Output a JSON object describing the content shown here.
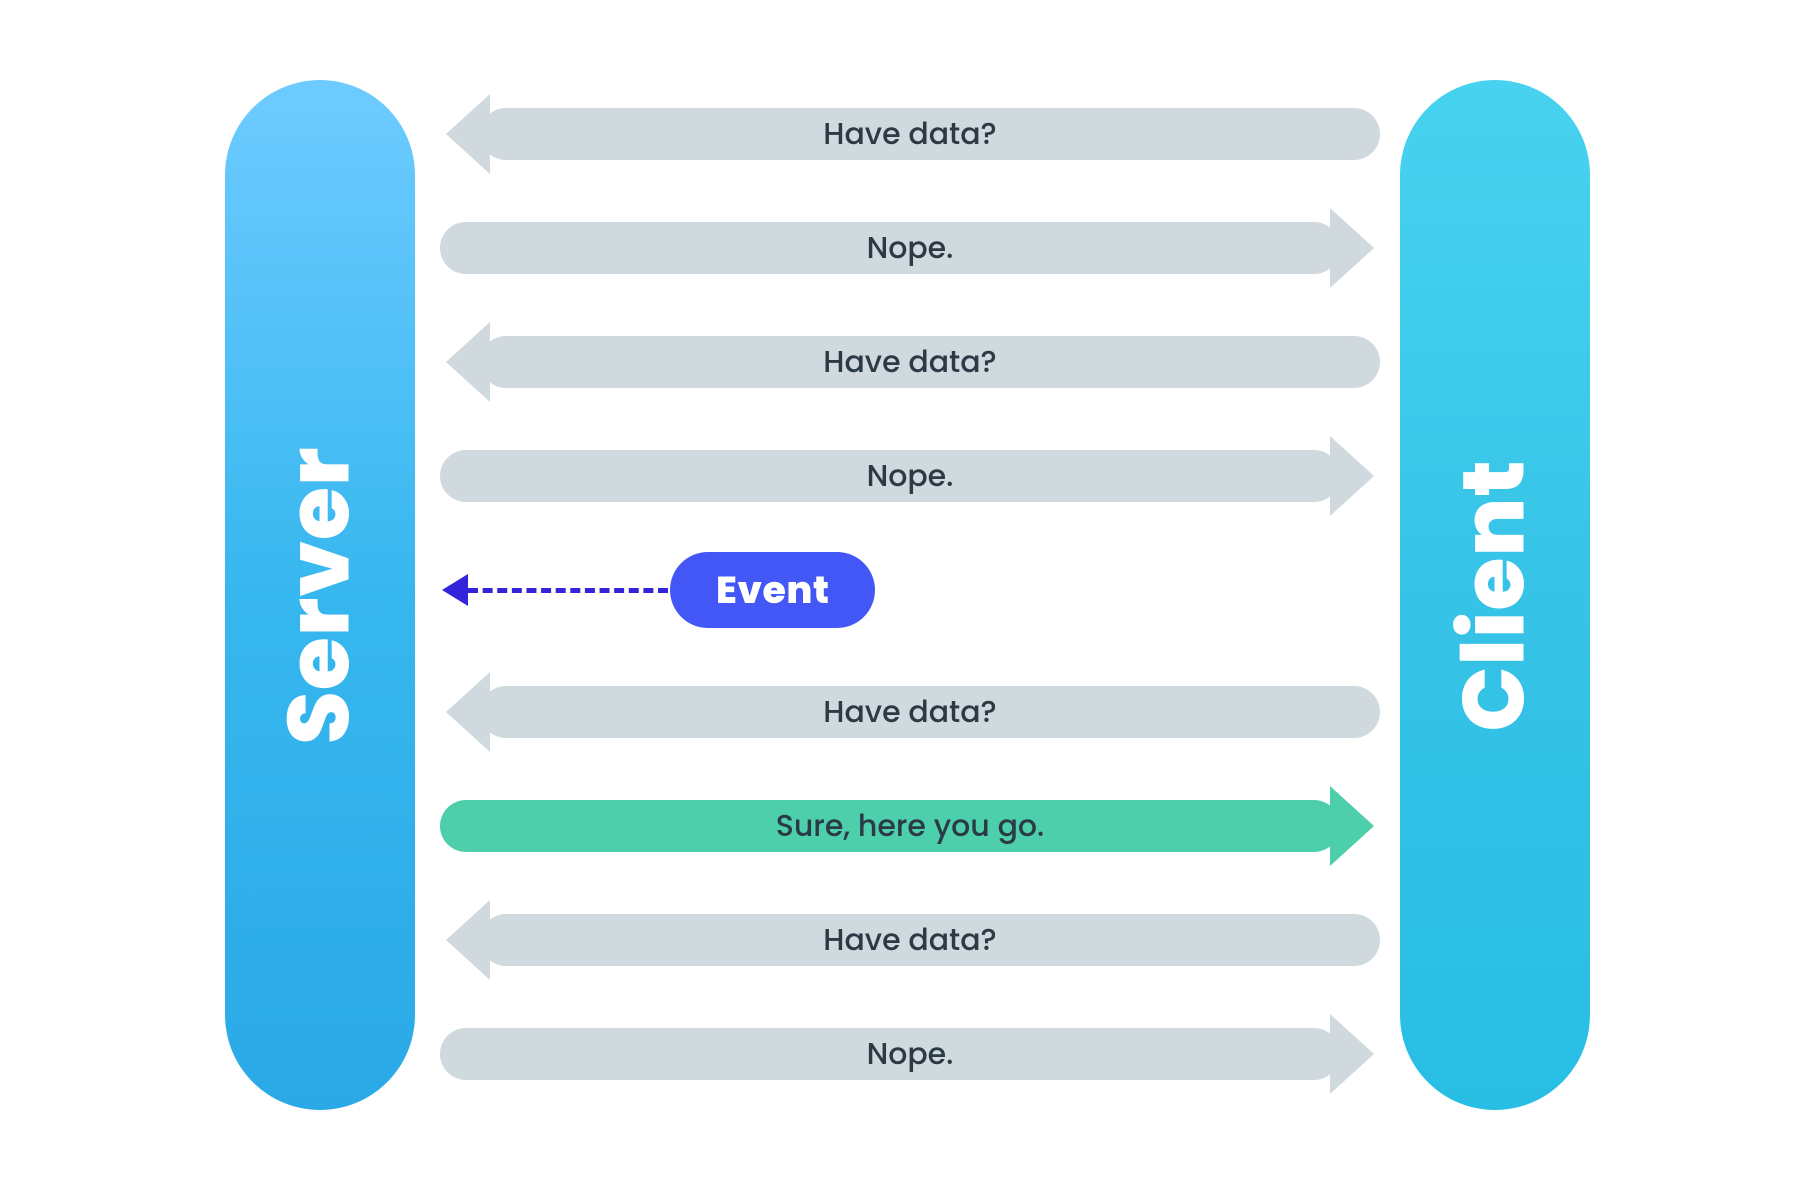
{
  "pillars": {
    "left_label": "Server",
    "right_label": "Client"
  },
  "rows": [
    {
      "direction": "left",
      "style": "gray",
      "label": "Have data?"
    },
    {
      "direction": "right",
      "style": "gray",
      "label": "Nope."
    },
    {
      "direction": "left",
      "style": "gray",
      "label": "Have data?"
    },
    {
      "direction": "right",
      "style": "gray",
      "label": "Nope."
    },
    {
      "direction": "event",
      "style": "blue",
      "label": "Event"
    },
    {
      "direction": "left",
      "style": "gray",
      "label": "Have data?"
    },
    {
      "direction": "right",
      "style": "green",
      "label": "Sure, here you go."
    },
    {
      "direction": "left",
      "style": "gray",
      "label": "Have data?"
    },
    {
      "direction": "right",
      "style": "gray",
      "label": "Nope."
    }
  ],
  "colors": {
    "arrow_gray": "#cfd9de",
    "arrow_green": "#4dcfab",
    "event_pill": "#4257f5",
    "event_dash": "#3224d9",
    "text": "#2b3a45",
    "pillar_top": "#6ecbff",
    "pillar_bottom": "#28bee4"
  }
}
